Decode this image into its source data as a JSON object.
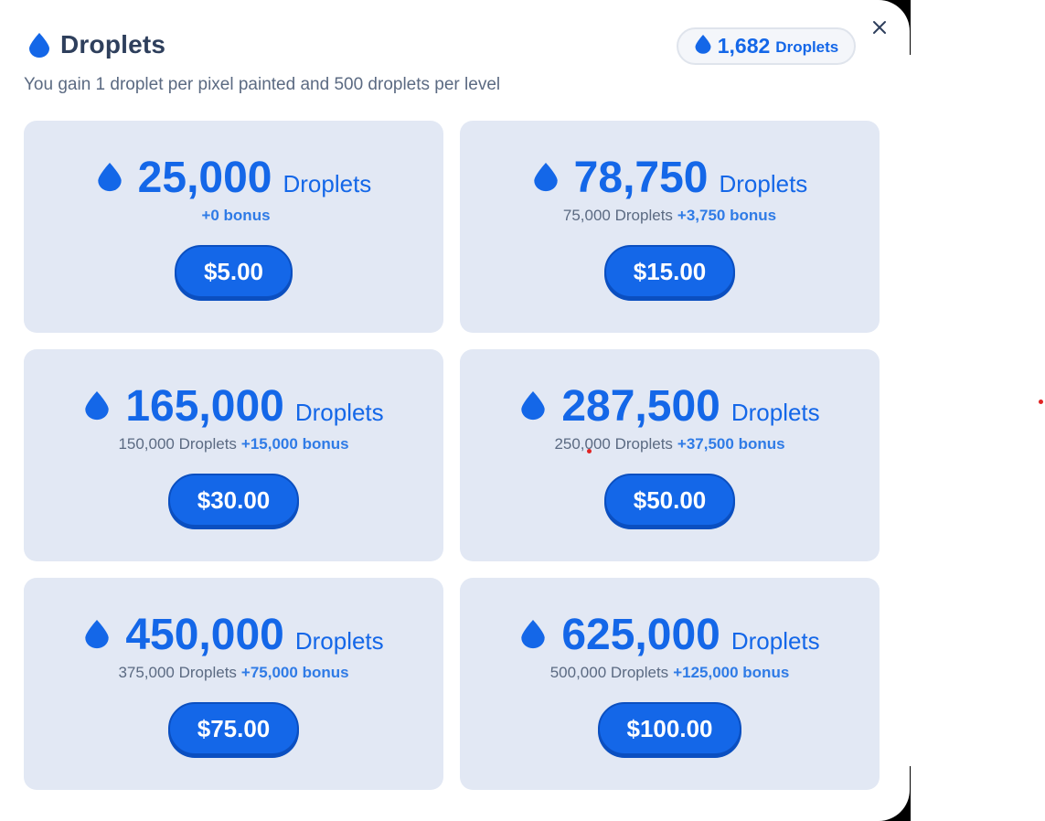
{
  "header": {
    "title": "Droplets",
    "subtitle": "You gain 1 droplet per pixel painted and 500 droplets per level",
    "balance_amount": "1,682",
    "balance_unit": "Droplets"
  },
  "icons": {
    "droplet": "droplet-icon",
    "close": "close-icon"
  },
  "colors": {
    "accent": "#1467e8",
    "card_bg": "#e2e8f4",
    "title": "#2e3f5c"
  },
  "packages": [
    {
      "amount": "25,000",
      "unit": "Droplets",
      "base": "",
      "bonus": "+0 bonus",
      "price": "$5.00"
    },
    {
      "amount": "78,750",
      "unit": "Droplets",
      "base": "75,000 Droplets",
      "bonus": "+3,750 bonus",
      "price": "$15.00"
    },
    {
      "amount": "165,000",
      "unit": "Droplets",
      "base": "150,000 Droplets",
      "bonus": "+15,000 bonus",
      "price": "$30.00"
    },
    {
      "amount": "287,500",
      "unit": "Droplets",
      "base": "250,000 Droplets",
      "bonus": "+37,500 bonus",
      "price": "$50.00"
    },
    {
      "amount": "450,000",
      "unit": "Droplets",
      "base": "375,000 Droplets",
      "bonus": "+75,000 bonus",
      "price": "$75.00"
    },
    {
      "amount": "625,000",
      "unit": "Droplets",
      "base": "500,000 Droplets",
      "bonus": "+125,000 bonus",
      "price": "$100.00"
    }
  ]
}
